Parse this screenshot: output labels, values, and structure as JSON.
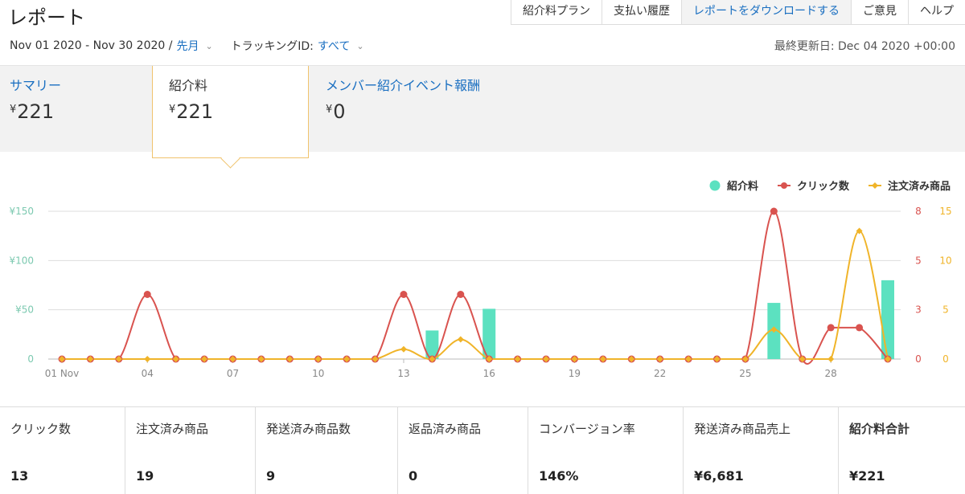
{
  "header": {
    "title": "レポート"
  },
  "nav": {
    "items": [
      {
        "label": "紹介料プラン"
      },
      {
        "label": "支払い履歴"
      },
      {
        "label": "レポートをダウンロードする"
      },
      {
        "label": "ご意見"
      },
      {
        "label": "ヘルプ"
      }
    ]
  },
  "filters": {
    "date_range": "Nov 01 2020 - Nov 30 2020 /",
    "period": "先月",
    "tracking_label": "トラッキングID:",
    "tracking_value": "すべて"
  },
  "last_updated": "最終更新日: Dec 04 2020 +00:00",
  "summary_tabs": {
    "summary": {
      "label": "サマリー",
      "currency": "¥",
      "value": "221"
    },
    "fee": {
      "label": "紹介料",
      "currency": "¥",
      "value": "221"
    },
    "event": {
      "label": "メンバー紹介イベント報酬",
      "currency": "¥",
      "value": "0"
    }
  },
  "colors": {
    "fee": "#5ce1c0",
    "clicks": "#d9534f",
    "orders": "#f0b429",
    "link": "#1a6fc1"
  },
  "chart_data": {
    "type": "bar+line",
    "legend": [
      "紹介料",
      "クリック数",
      "注文済み商品"
    ],
    "left_axis": {
      "ticks": [
        "¥150",
        "¥100",
        "¥50",
        "0"
      ],
      "max": 150
    },
    "right_axis_clicks": {
      "ticks": [
        "8",
        "5",
        "3",
        "0"
      ],
      "max": 8
    },
    "right_axis_orders": {
      "ticks": [
        "15",
        "10",
        "5",
        "0"
      ],
      "max": 15
    },
    "x_ticks": [
      {
        "day": 1,
        "label": "01 Nov"
      },
      {
        "day": 4,
        "label": "04"
      },
      {
        "day": 7,
        "label": "07"
      },
      {
        "day": 10,
        "label": "10"
      },
      {
        "day": 13,
        "label": "13"
      },
      {
        "day": 16,
        "label": "16"
      },
      {
        "day": 19,
        "label": "19"
      },
      {
        "day": 22,
        "label": "22"
      },
      {
        "day": 25,
        "label": "25"
      },
      {
        "day": 28,
        "label": "28"
      }
    ],
    "days": [
      1,
      2,
      3,
      4,
      5,
      6,
      7,
      8,
      9,
      10,
      11,
      12,
      13,
      14,
      15,
      16,
      17,
      18,
      19,
      20,
      21,
      22,
      23,
      24,
      25,
      26,
      27,
      28,
      29,
      30
    ],
    "fee": [
      0,
      0,
      0,
      0,
      0,
      0,
      0,
      0,
      0,
      0,
      0,
      0,
      0,
      29,
      0,
      51,
      0,
      0,
      0,
      0,
      0,
      0,
      0,
      0,
      0,
      57,
      0,
      0,
      0,
      80
    ],
    "clicks": [
      0,
      0,
      0,
      3.5,
      0,
      0,
      0,
      0,
      0,
      0,
      0,
      0,
      3.5,
      0,
      3.5,
      0,
      0,
      0,
      0,
      0,
      0,
      0,
      0,
      0,
      0,
      8,
      0,
      1.7,
      1.7,
      0
    ],
    "orders": [
      0,
      0,
      0,
      0,
      0,
      0,
      0,
      0,
      0,
      0,
      0,
      0,
      1,
      0,
      2,
      0,
      0,
      0,
      0,
      0,
      0,
      0,
      0,
      0,
      0,
      3,
      0,
      0,
      13,
      0
    ]
  },
  "stats": [
    {
      "label": "クリック数",
      "value": "13"
    },
    {
      "label": "注文済み商品",
      "value": "19"
    },
    {
      "label": "発送済み商品数",
      "value": "9"
    },
    {
      "label": "返品済み商品",
      "value": "0"
    },
    {
      "label": "コンバージョン率",
      "value": "146%"
    },
    {
      "label": "発送済み商品売上",
      "value": "¥6,681"
    },
    {
      "label": "紹介料合計",
      "value": "¥221"
    }
  ]
}
